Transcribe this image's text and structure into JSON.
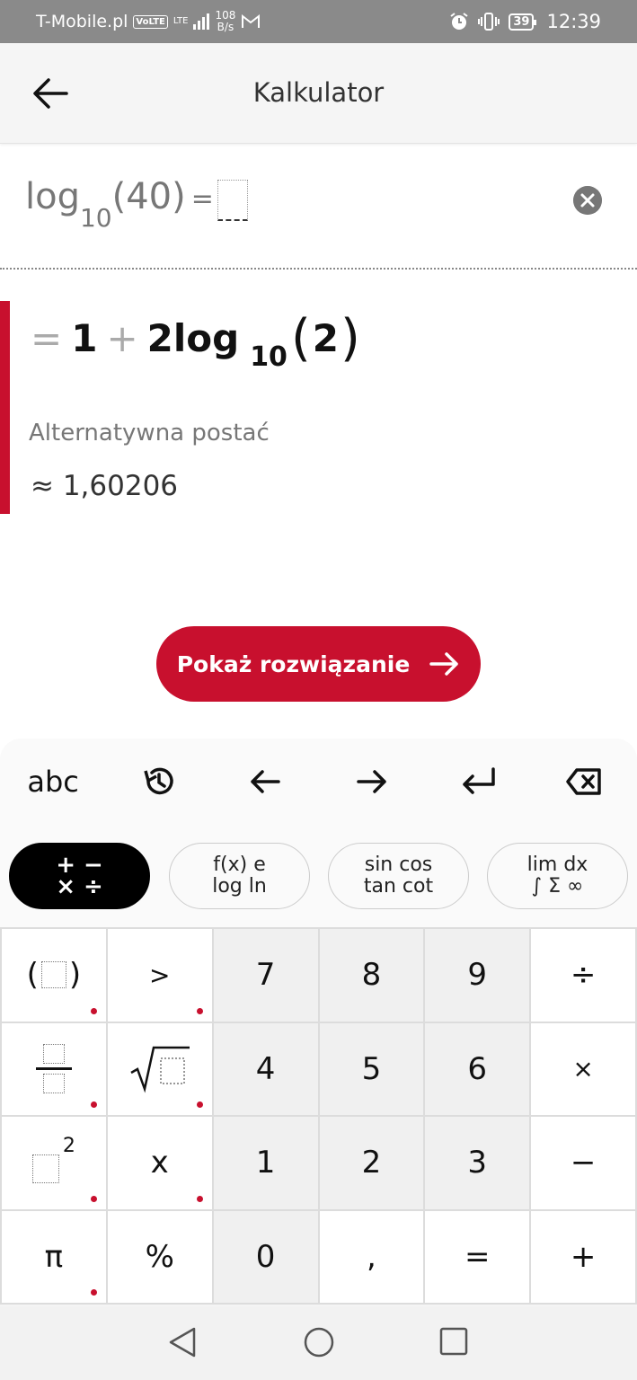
{
  "status_bar": {
    "carrier": "T-Mobile.pl",
    "volte": "VoLTE",
    "network": "LTE",
    "speed_value": "108",
    "speed_unit": "B/s",
    "battery": "39",
    "time": "12:39"
  },
  "app_bar": {
    "title": "Kalkulator"
  },
  "input": {
    "func": "log",
    "base": "10",
    "argument": "(40)",
    "equals": "="
  },
  "result": {
    "equals": "=",
    "term1": "1",
    "plus": "+",
    "coef": "2log",
    "base": "10",
    "open_paren": "(",
    "arg": "2",
    "close_paren": ")",
    "alt_label": "Alternatywna postać",
    "approx": "≈ 1,60206"
  },
  "cta": {
    "label": "Pokaż rozwiązanie"
  },
  "keyboard": {
    "toolbar": {
      "abc": "abc"
    },
    "tabs": {
      "arith_line1": "+ −",
      "arith_line2": "× ÷",
      "func_line1": "f(x)  e",
      "func_line2": "log  ln",
      "trig_line1": "sin cos",
      "trig_line2": "tan cot",
      "calc_line1": "lim  dx",
      "calc_line2": "∫ Σ ∞"
    },
    "keys": {
      "paren_open": "(",
      "paren_close": ")",
      "greater": ">",
      "k7": "7",
      "k8": "8",
      "k9": "9",
      "divide": "÷",
      "k4": "4",
      "k5": "5",
      "k6": "6",
      "multiply": "×",
      "power": "2",
      "x": "x",
      "k1": "1",
      "k2": "2",
      "k3": "3",
      "minus": "−",
      "pi": "π",
      "percent": "%",
      "k0": "0",
      "comma": ",",
      "equals": "=",
      "plus": "+"
    }
  },
  "colors": {
    "accent": "#c8102e",
    "status_bar": "#8a8a8a"
  }
}
